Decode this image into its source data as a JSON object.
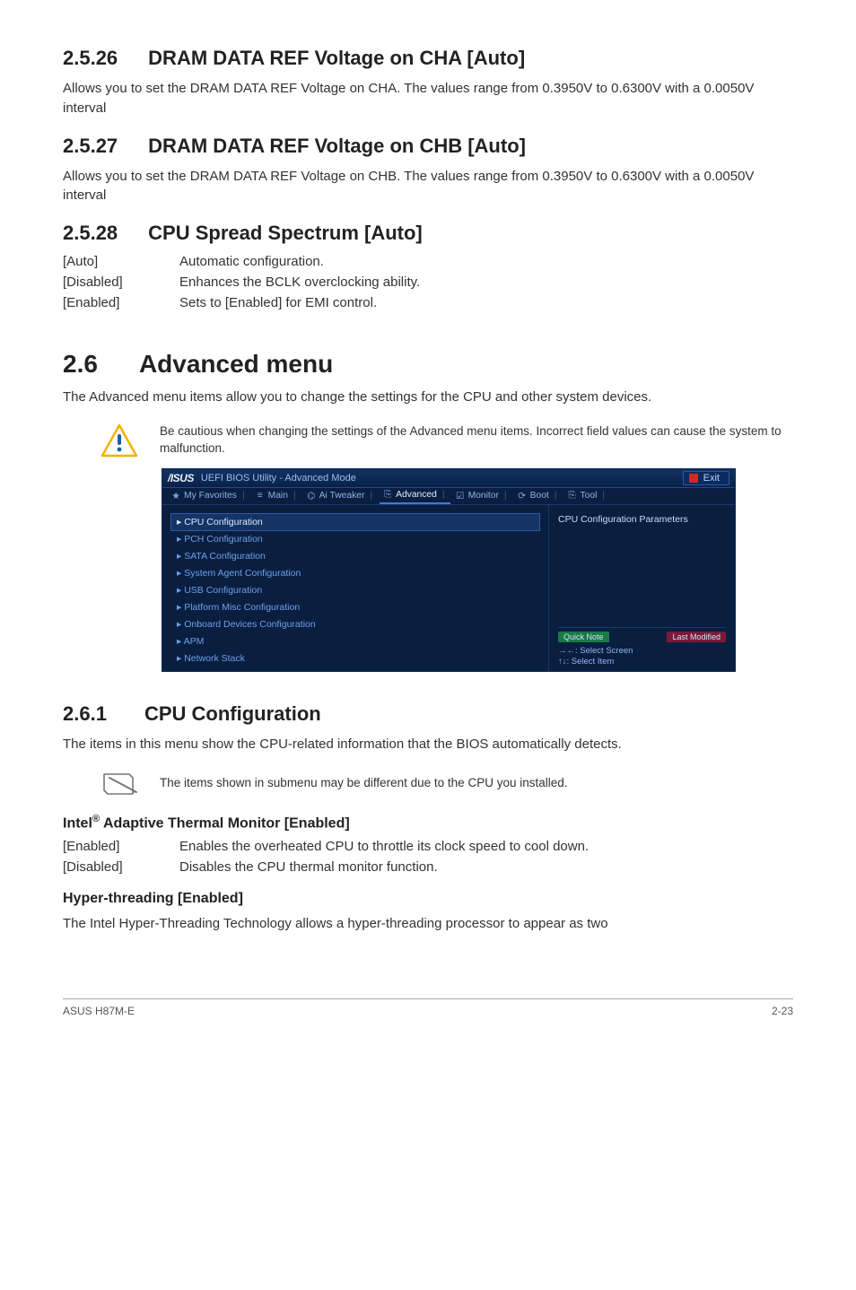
{
  "sec_2526": {
    "num": "2.5.26",
    "title": "DRAM DATA REF Voltage on CHA [Auto]",
    "body": "Allows you to set the DRAM DATA REF Voltage on CHA. The values range from 0.3950V to 0.6300V with a 0.0050V interval"
  },
  "sec_2527": {
    "num": "2.5.27",
    "title": "DRAM DATA REF Voltage on CHB [Auto]",
    "body": "Allows you to set the DRAM DATA REF Voltage on CHB. The values range from 0.3950V to 0.6300V with a 0.0050V interval"
  },
  "sec_2528": {
    "num": "2.5.28",
    "title": "CPU Spread Spectrum [Auto]",
    "rows": [
      {
        "k": "[Auto]",
        "v": "Automatic configuration."
      },
      {
        "k": "[Disabled]",
        "v": "Enhances the BCLK overclocking ability."
      },
      {
        "k": "[Enabled]",
        "v": "Sets to [Enabled] for EMI control."
      }
    ]
  },
  "topic_26": {
    "num": "2.6",
    "title": "Advanced menu",
    "body": "The Advanced menu items allow you to change the settings for the CPU and other system devices.",
    "callout": "Be cautious when changing the settings of the Advanced menu items. Incorrect field values can cause the system to malfunction."
  },
  "bios": {
    "brand": "/ISUS",
    "mode": "UEFI BIOS Utility - Advanced Mode",
    "exit": "Exit",
    "tabs": [
      {
        "icon": "★",
        "label": "My Favorites"
      },
      {
        "icon": "≡",
        "label": "Main"
      },
      {
        "icon": "⌬",
        "label": "Ai Tweaker"
      },
      {
        "icon": "⎘",
        "label": "Advanced",
        "active": true
      },
      {
        "icon": "☑",
        "label": "Monitor"
      },
      {
        "icon": "⟳",
        "label": "Boot"
      },
      {
        "icon": "⎘",
        "label": "Tool"
      }
    ],
    "items": [
      {
        "label": "CPU Configuration",
        "selected": true
      },
      {
        "label": "PCH Configuration"
      },
      {
        "label": "SATA Configuration"
      },
      {
        "label": "System Agent Configuration"
      },
      {
        "label": "USB Configuration"
      },
      {
        "label": "Platform Misc Configuration"
      },
      {
        "label": "Onboard Devices Configuration"
      },
      {
        "label": "APM"
      },
      {
        "label": "Network Stack"
      }
    ],
    "help_title": "CPU Configuration Parameters",
    "badge_qn": "Quick Note",
    "badge_lm": "Last Modified",
    "hint1": "→←: Select Screen",
    "hint2": "↑↓: Select Item"
  },
  "sec_261": {
    "num": "2.6.1",
    "title": "CPU Configuration",
    "body": "The items in this menu show the CPU-related information that the BIOS automatically detects.",
    "callout": "The items shown in submenu may be different due to the CPU you installed."
  },
  "sub_intel": {
    "title_prefix": "Intel",
    "title_rest": " Adaptive Thermal Monitor [Enabled]",
    "rows": [
      {
        "k": "[Enabled]",
        "v": "Enables the overheated CPU to throttle its clock speed to cool down."
      },
      {
        "k": "[Disabled]",
        "v": "Disables the CPU thermal monitor function."
      }
    ]
  },
  "sub_ht": {
    "title": "Hyper-threading [Enabled]",
    "body": "The Intel Hyper-Threading Technology allows a hyper-threading processor to appear as two"
  },
  "footer": {
    "left": "ASUS H87M-E",
    "right": "2-23"
  }
}
